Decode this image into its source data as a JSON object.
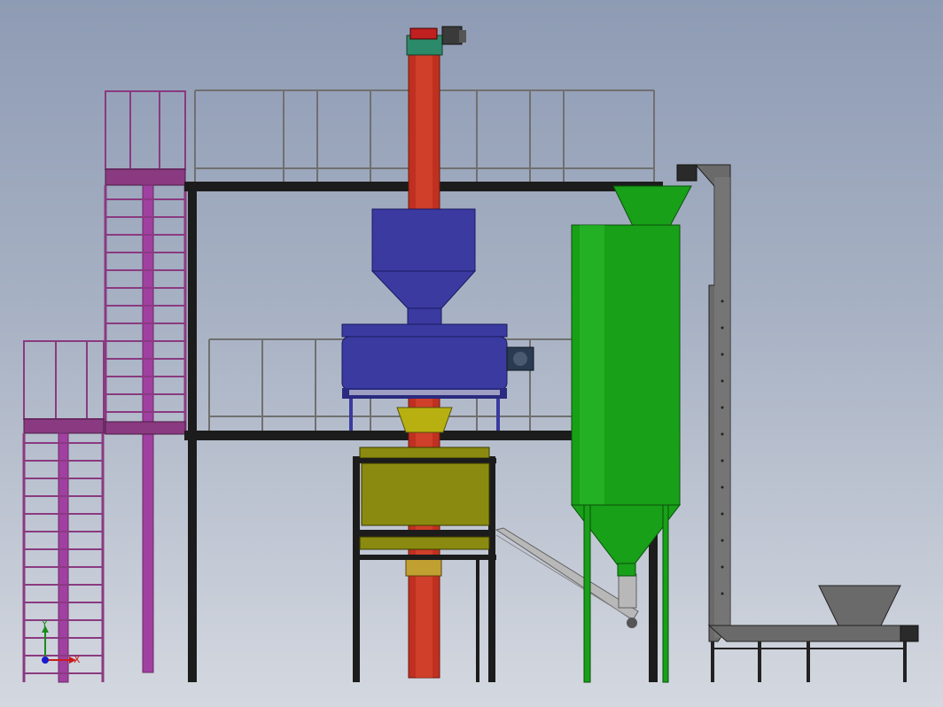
{
  "triad": {
    "x_label": "X",
    "y_label": "Y"
  },
  "colors": {
    "frame": "#1c1c1c",
    "elevator": "#c03020",
    "mixer": "#3a3aa0",
    "silo": "#18a018",
    "weigh_hopper": "#8a8a10",
    "platform": "#8a3a80",
    "conveyor": "#6a6a6a",
    "screw": "#b8b8b8",
    "rail": "#707070"
  }
}
